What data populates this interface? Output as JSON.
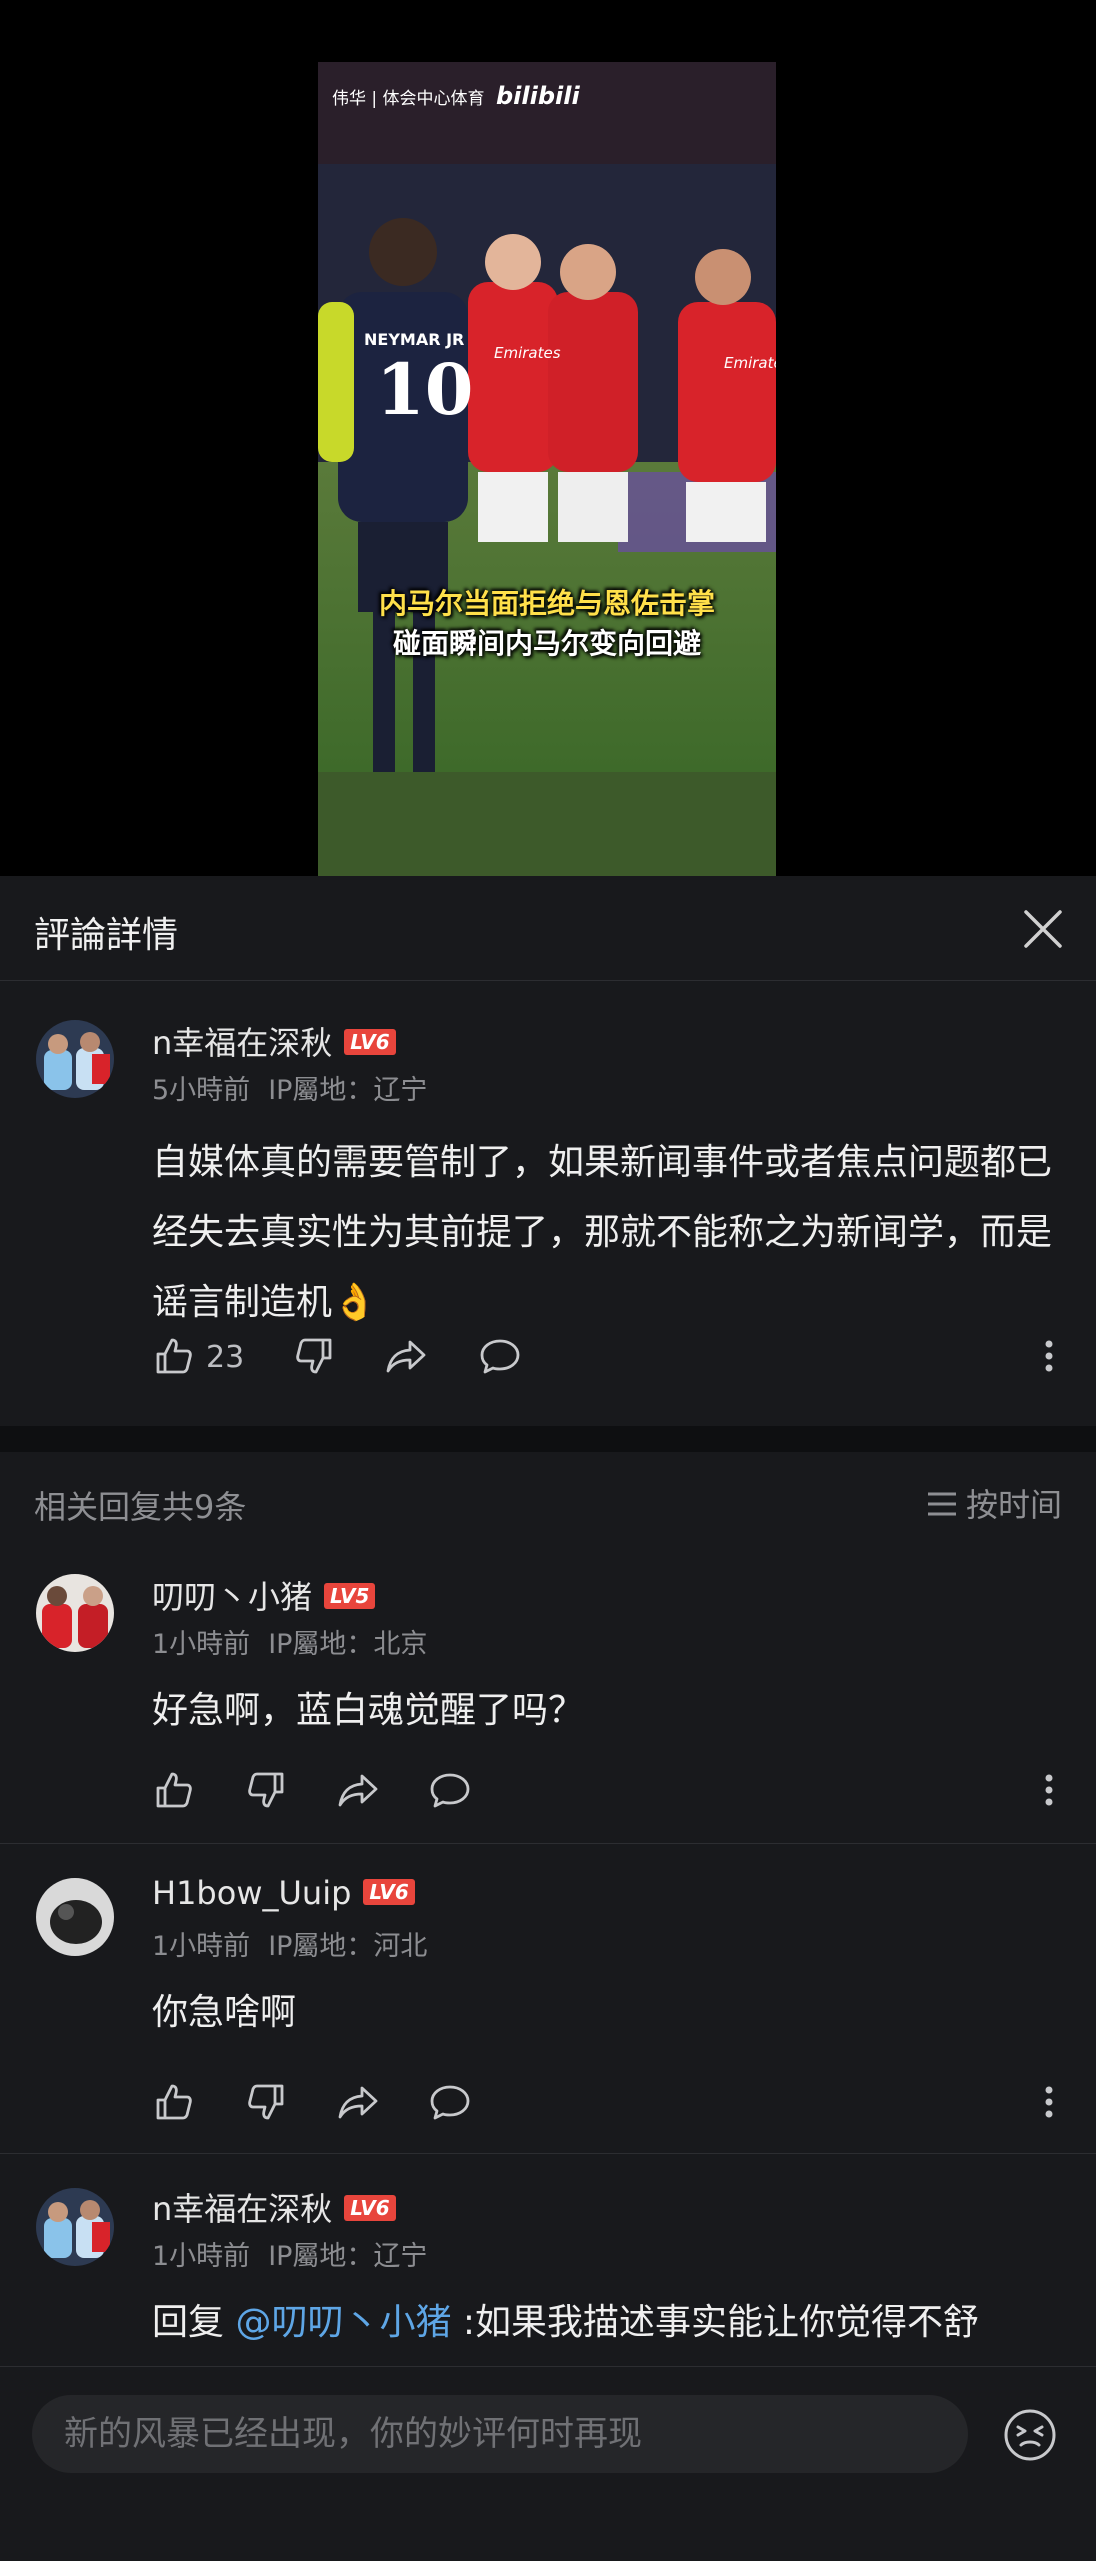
{
  "video": {
    "watermark_text": "伟华 | 体会中心体育",
    "watermark_logo": "bilibili",
    "jersey_name": "NEYMAR JR",
    "jersey_number": "10",
    "sponsor": "Emirates",
    "caption_line1": "内马尔当面拒绝与恩佐击掌",
    "caption_line2": "碰面瞬间内马尔变向回避"
  },
  "panel": {
    "title": "評論詳情",
    "close_icon": "close-icon"
  },
  "main_comment": {
    "username": "n幸福在深秋",
    "level": "LV6",
    "time": "5小時前",
    "ip": "IP屬地：辽宁",
    "text": "自媒体真的需要管制了，如果新闻事件或者焦点问题都已经失去真实性为其前提了，那就不能称之为新闻学，而是谣言制造机",
    "emoji": "👌",
    "likes": "23"
  },
  "replies_header": {
    "count_text": "相关回复共9条",
    "sort_label": "按时间"
  },
  "replies": [
    {
      "username": "叨叨丶小猪",
      "level": "LV5",
      "time": "1小時前",
      "ip": "IP屬地：北京",
      "text": "好急啊，蓝白魂觉醒了吗？"
    },
    {
      "username": "H1bow_Uuip",
      "level": "LV6",
      "time": "1小時前",
      "ip": "IP屬地：河北",
      "text": "你急啥啊"
    },
    {
      "username": "n幸福在深秋",
      "level": "LV6",
      "time": "1小時前",
      "ip": "IP屬地：辽宁",
      "reply_prefix": "回复 ",
      "mention": "@叨叨丶小猪",
      "text": " :如果我描述事实能让你觉得不舒"
    }
  ],
  "input": {
    "placeholder": "新的风暴已经出现，你的妙评何时再现"
  },
  "colors": {
    "panel_bg": "#18191c",
    "level_badge": "#e8453c",
    "mention": "#5ea6e6"
  }
}
